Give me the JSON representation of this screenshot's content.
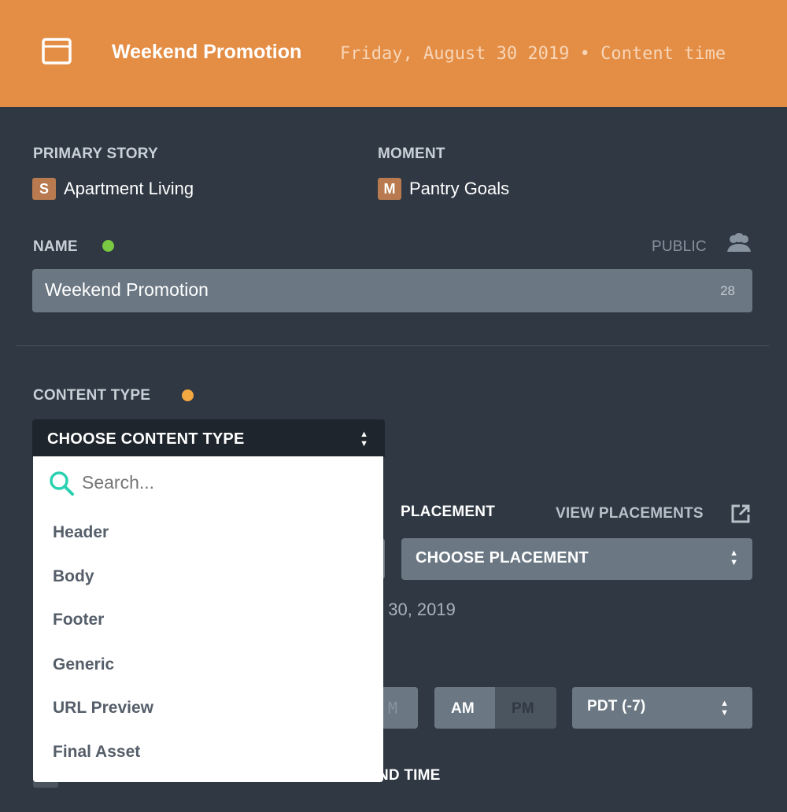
{
  "header": {
    "title": "Weekend Promotion",
    "subtitle": "Friday, August 30 2019 • Content time",
    "icon": "browser-window-icon",
    "color": "#E48D45"
  },
  "primary_story": {
    "label": "PRIMARY STORY",
    "badge": "S",
    "value": "Apartment Living"
  },
  "moment": {
    "label": "MOMENT",
    "badge": "M",
    "value": "Pantry Goals"
  },
  "name": {
    "label": "NAME",
    "status_color": "#7ac943",
    "visibility": "PUBLIC",
    "visibility_icon": "users-icon",
    "value": "Weekend Promotion",
    "char_count": "28"
  },
  "content_type": {
    "label": "CONTENT TYPE",
    "status_color": "#f5a742",
    "select_label": "CHOOSE CONTENT TYPE",
    "search_placeholder": "Search...",
    "options": [
      "Header",
      "Body",
      "Footer",
      "Generic",
      "URL Preview",
      "Final Asset"
    ]
  },
  "placement": {
    "label": "PLACEMENT",
    "view_link": "VIEW PLACEMENTS",
    "select_label": "CHOOSE PLACEMENT"
  },
  "date_fragment": "st 30, 2019",
  "time": {
    "fragment": "M",
    "am": "AM",
    "pm": "PM",
    "timezone": "PDT (-7)"
  },
  "end_time_fragment": "ND TIME"
}
